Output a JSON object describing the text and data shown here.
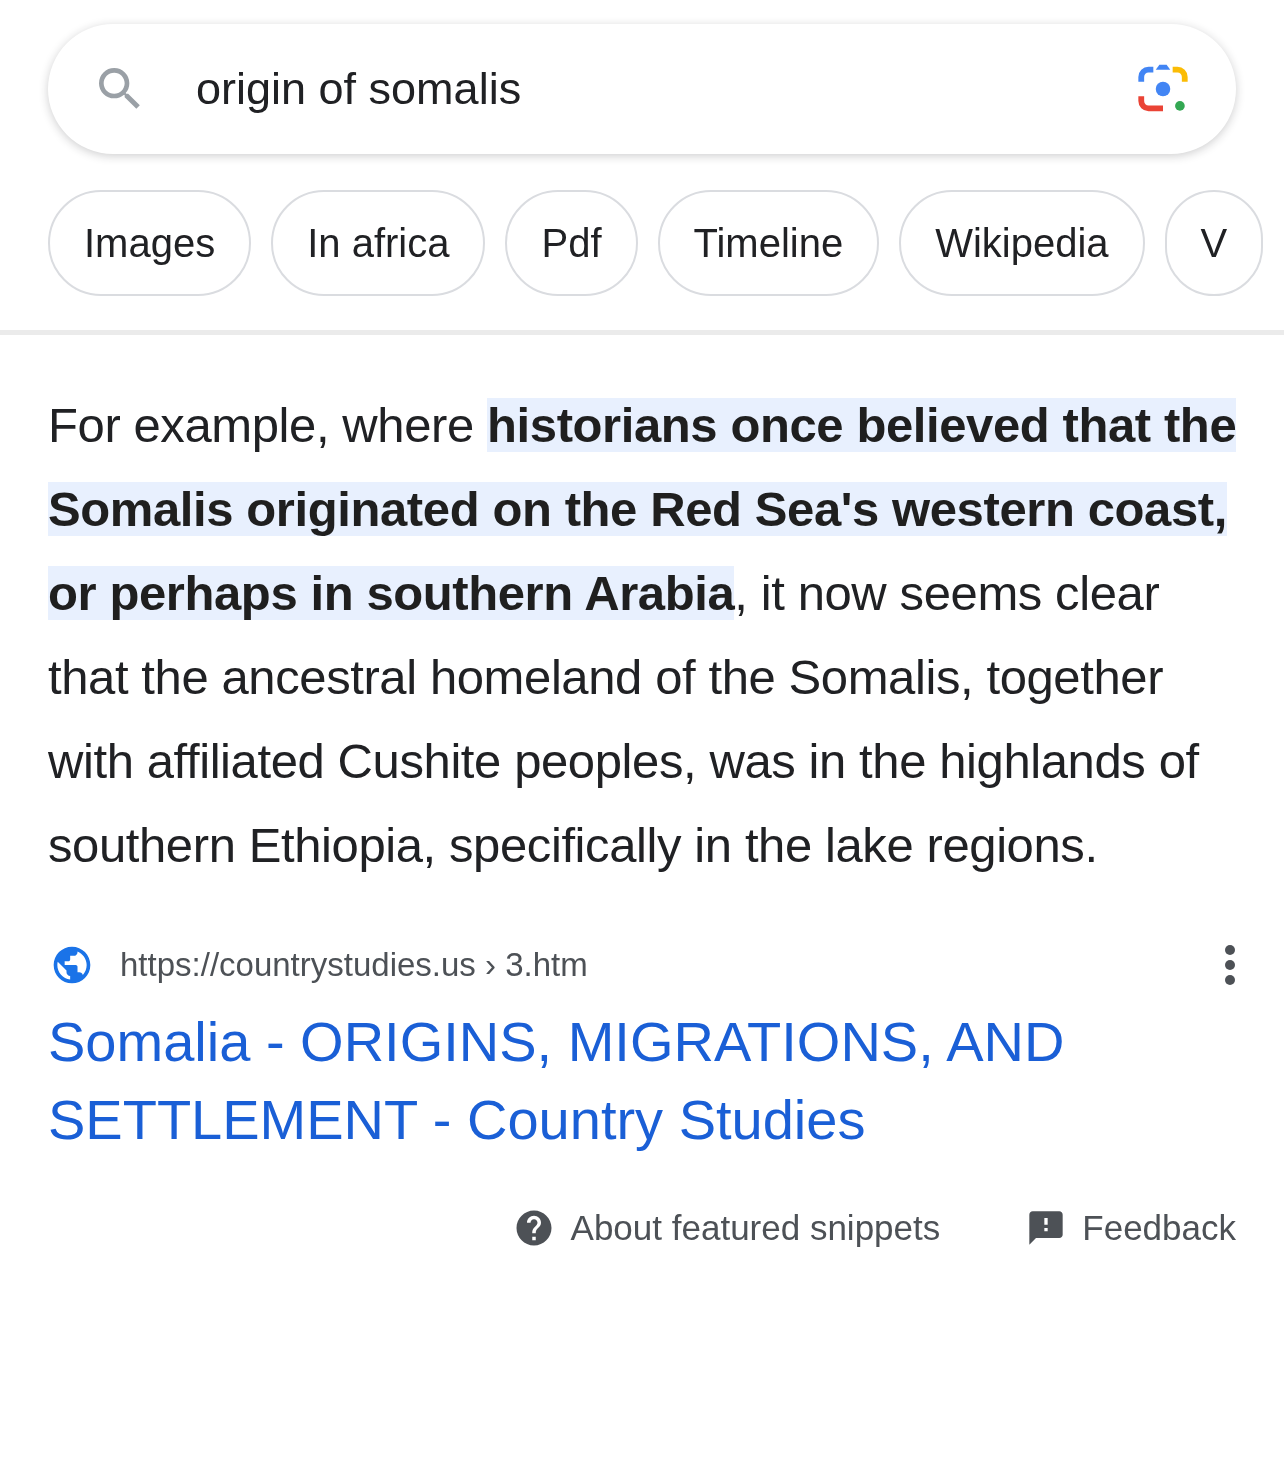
{
  "search": {
    "value": "origin of somalis"
  },
  "chips": [
    {
      "label": "Images"
    },
    {
      "label": "In africa"
    },
    {
      "label": "Pdf"
    },
    {
      "label": "Timeline"
    },
    {
      "label": "Wikipedia"
    },
    {
      "label": "V"
    }
  ],
  "snippet": {
    "before": "For example, where ",
    "highlight": "historians once believed that the Somalis originated on the Red Sea's western coast, or perhaps in southern Arabia",
    "after": ", it now seems clear that the ancestral homeland of the Somalis, together with affiliated Cushite peoples, was in the highlands of southern Ethiopia, specifically in the lake regions."
  },
  "source": {
    "url": "https://countrystudies.us › 3.htm",
    "title": "Somalia - ORIGINS, MIGRATIONS, AND SETTLEMENT - Country Studies"
  },
  "footer": {
    "about": "About featured snippets",
    "feedback": "Feedback"
  }
}
